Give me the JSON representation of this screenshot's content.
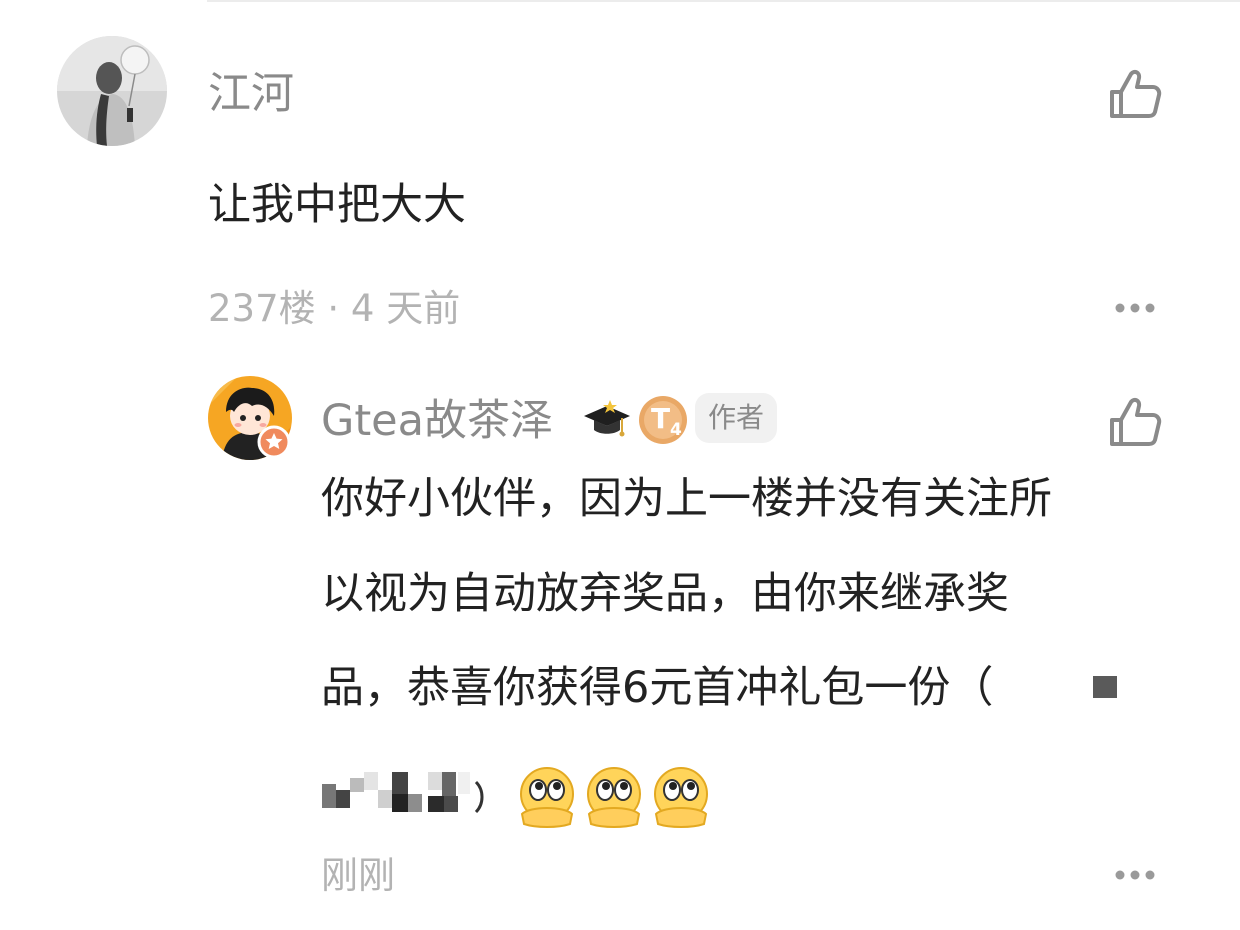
{
  "comment": {
    "username": "江河",
    "text": "让我中把大大",
    "floor": "237楼",
    "separator": "·",
    "time": "4 天前",
    "avatar_icon": "user-avatar-grayscale-balloon",
    "like_icon": "thumbs-up-outline-icon",
    "more_icon": "ellipsis-icon"
  },
  "reply": {
    "username": "Gtea故茶泽",
    "author_label": "作者",
    "level_text": "T",
    "level_sub": "4",
    "line1": "你好小伙伴，因为上一楼并没有关注所",
    "line2": "以视为自动放弃奖品，由你来继承奖",
    "line3": "品，恭喜你获得6元首冲礼包一份（",
    "time": "刚刚",
    "emojis": [
      "eyes-peeking-emoji",
      "eyes-peeking-emoji",
      "eyes-peeking-emoji"
    ],
    "colors": {
      "level_badge": "#e9a866",
      "avatar_bg": "#f6a623",
      "author_badge_bg": "#f1f1f1"
    }
  }
}
